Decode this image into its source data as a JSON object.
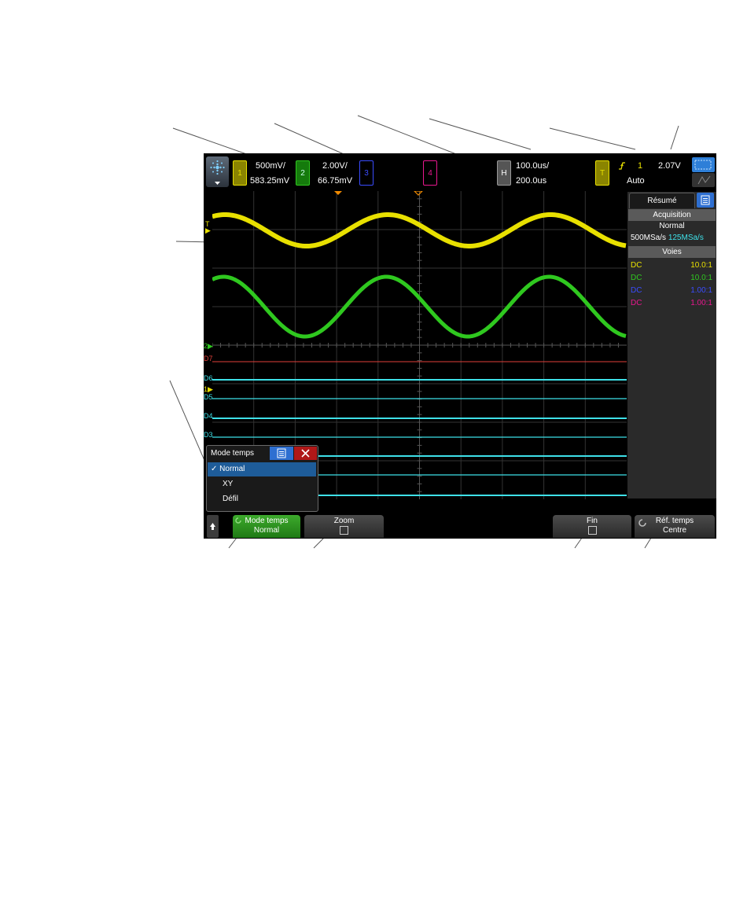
{
  "colors": {
    "ch1": "#e8e000",
    "ch2": "#2fc81f",
    "ch3": "#3a4cff",
    "ch4": "#e8178e",
    "digital": "#3ee0e8",
    "d7": "#e0403a",
    "accent": "#2e6fd1",
    "softkey_active": "#2b9a1c"
  },
  "topbar": {
    "logo_icon": "starburst-menu-icon",
    "ch1": {
      "label": "1",
      "scale": "500mV/",
      "offset": "583.25mV"
    },
    "ch2": {
      "label": "2",
      "scale": "2.00V/",
      "offset": "66.75mV"
    },
    "ch3": {
      "label": "3"
    },
    "ch4": {
      "label": "4"
    },
    "horizontal": {
      "label": "H",
      "scale": "100.0us/",
      "delay": "200.0us"
    },
    "trigger": {
      "label": "T",
      "edge_icon": "rising-edge-icon",
      "source": "1",
      "level": "2.07V",
      "mode": "Auto"
    },
    "touch_icon": "touch-zone-icon"
  },
  "waveform": {
    "ch1_marker": "T",
    "ch2_marker": "2",
    "ch1_ref_marker": "1",
    "digital_labels": [
      "D7",
      "D6",
      "D5",
      "D4",
      "D3"
    ]
  },
  "side_panel": {
    "tab_label": "Résumé",
    "acquisition_header": "Acquisition",
    "acq_mode": "Normal",
    "sample_rate": "500MSa/s",
    "sample_rate_alt": "125MSa/s",
    "channels_header": "Voies",
    "channels": [
      {
        "coupling": "DC",
        "probe": "10.0:1",
        "color": "#e8e000"
      },
      {
        "coupling": "DC",
        "probe": "10.0:1",
        "color": "#2fc81f"
      },
      {
        "coupling": "DC",
        "probe": "1.00:1",
        "color": "#3a4cff"
      },
      {
        "coupling": "DC",
        "probe": "1.00:1",
        "color": "#e8178e"
      }
    ]
  },
  "menu": {
    "title": "Mode temps",
    "items": [
      {
        "label": "Normal",
        "selected": true
      },
      {
        "label": "XY",
        "selected": false
      },
      {
        "label": "Défil",
        "selected": false
      }
    ]
  },
  "softkeys": {
    "home_icon": "up-arrow-icon",
    "mode": {
      "title": "Mode temps",
      "value": "Normal"
    },
    "zoom": {
      "title": "Zoom"
    },
    "fin": {
      "title": "Fin"
    },
    "ref": {
      "title": "Réf. temps",
      "value": "Centre"
    }
  }
}
